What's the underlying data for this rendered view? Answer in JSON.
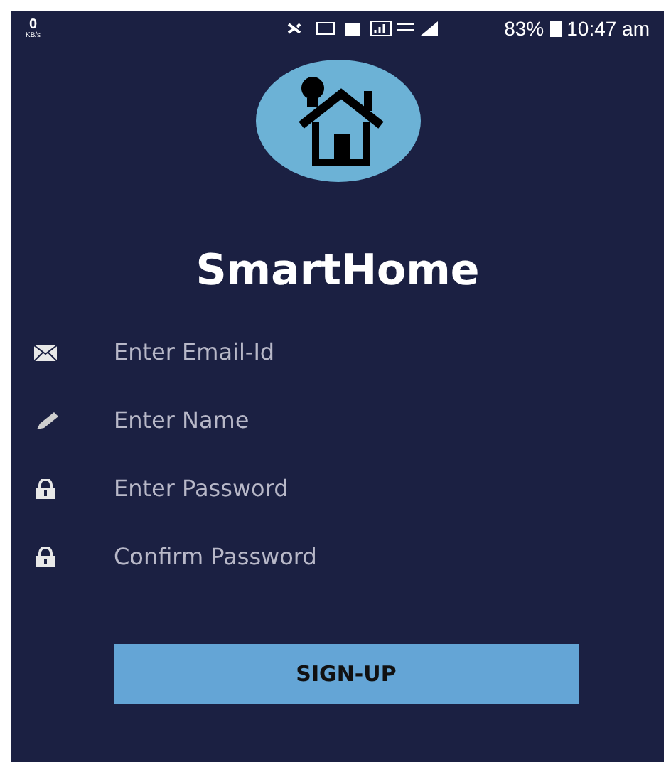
{
  "status_bar": {
    "speed": "0",
    "speed_unit": "KB/s",
    "battery": "83%",
    "time": "10:47 am"
  },
  "app_title": "SmartHome",
  "fields": [
    {
      "kind": "email",
      "placeholder": "Enter Email-Id"
    },
    {
      "kind": "name",
      "placeholder": "Enter Name"
    },
    {
      "kind": "password",
      "placeholder": "Enter Password"
    },
    {
      "kind": "password",
      "placeholder": "Confirm Password"
    }
  ],
  "button": "SIGN-UP"
}
